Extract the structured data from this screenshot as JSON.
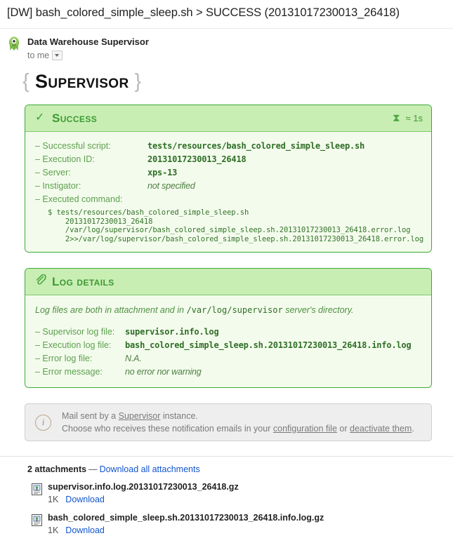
{
  "email": {
    "subject": "[DW] bash_colored_simple_sleep.sh > SUCCESS (20131017230013_26418)",
    "sender_name": "Data Warehouse Supervisor",
    "recipient": "to me"
  },
  "logo": {
    "left_brace": "{",
    "word": "Supervisor",
    "right_brace": "}"
  },
  "success_panel": {
    "icon": "✓",
    "title": "Success",
    "duration_icon": "⧗",
    "duration": "≈ 1s",
    "fields": [
      {
        "label": "– Successful script:",
        "value": "tests/resources/bash_colored_simple_sleep.sh"
      },
      {
        "label": "– Execution ID:",
        "value": "20131017230013_26418"
      },
      {
        "label": "– Server:",
        "value": "xps-13"
      },
      {
        "label": "– Instigator:",
        "value": "not specified"
      }
    ],
    "executed_command_label": "– Executed command:",
    "executed_command": "$ tests/resources/bash_colored_simple_sleep.sh\n    20131017230013_26418\n    /var/log/supervisor/bash_colored_simple_sleep.sh.20131017230013_26418.error.log\n    2>>/var/log/supervisor/bash_colored_simple_sleep.sh.20131017230013_26418.error.log"
  },
  "log_panel": {
    "icon": "📎",
    "title": "Log details",
    "note_prefix": "Log files are both in attachment and in",
    "note_path": "/var/log/supervisor",
    "note_suffix": "server's directory.",
    "fields": [
      {
        "label": "– Supervisor log file:",
        "value": "supervisor.info.log"
      },
      {
        "label": "– Execution log file:",
        "value": "bash_colored_simple_sleep.sh.20131017230013_26418.info.log"
      },
      {
        "label": "– Error log file:",
        "value": "N.A."
      },
      {
        "label": "– Error message:",
        "value": "no error nor warning"
      }
    ]
  },
  "info_box": {
    "icon": "i",
    "line1_prefix": "Mail sent by a",
    "line1_link": "Supervisor",
    "line1_suffix": "instance.",
    "line2_prefix": "Choose who receives these notification emails in your",
    "line2_link1": "configuration file",
    "line2_mid": "or",
    "line2_link2": "deactivate them",
    "line2_suffix": "."
  },
  "attachments": {
    "count_label": "2 attachments",
    "dash": "—",
    "download_all": "Download all attachments",
    "items": [
      {
        "name": "supervisor.info.log.20131017230013_26418.gz",
        "size": "1K",
        "action": "Download"
      },
      {
        "name": "bash_colored_simple_sleep.sh.20131017230013_26418.info.log.gz",
        "size": "1K",
        "action": "Download"
      }
    ]
  },
  "colors": {
    "accent_green": "#3b9a33",
    "panel_border": "#3ba935",
    "panel_head_bg": "#c9eeb4",
    "panel_body_bg": "#f3fcec",
    "link_blue": "#1155cc"
  }
}
